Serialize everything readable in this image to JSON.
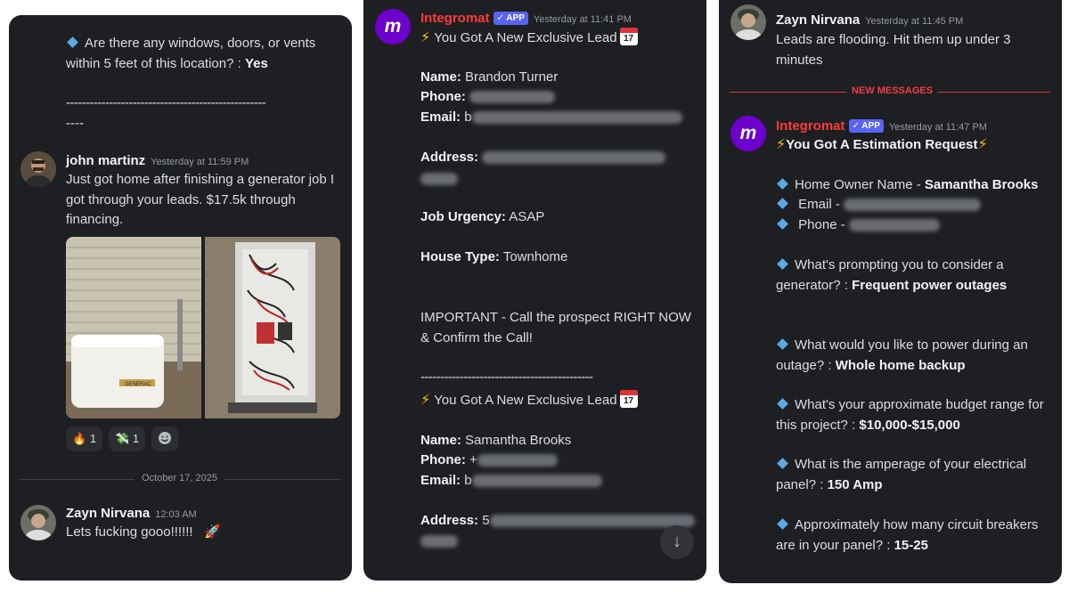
{
  "panel1": {
    "question": "Are there any windows, doors, or vents within 5 feet of this location? :",
    "answer": "Yes",
    "dashes_line1": "---------------------------------------------------",
    "dashes_line2": "----",
    "msg1": {
      "user": "john martinz",
      "time": "Yesterday at 11:59 PM",
      "text": "Just got home after finishing a generator job I got through your leads. $17.5k through financing.",
      "image_brand": "GENERAC"
    },
    "reactions": [
      {
        "emoji": "🔥",
        "count": "1"
      },
      {
        "emoji": "💸",
        "count": "1"
      }
    ],
    "date_separator": "October 17, 2025",
    "msg2": {
      "user": "Zayn Nirvana",
      "time": "12:03 AM",
      "text": "Lets fucking gooo!!!!!!",
      "emoji": "🚀"
    }
  },
  "panel2": {
    "app_name": "Integromat",
    "app_badge": "✓ APP",
    "time": "Yesterday at 11:41 PM",
    "lead_title": "You Got A New Exclusive Lead",
    "calendar_day": "17",
    "lead1": {
      "name_label": "Name:",
      "name_value": "Brandon Turner",
      "phone_label": "Phone:",
      "email_label": "Email:",
      "email_prefix": "b",
      "address_label": "Address:",
      "urgency_label": "Job Urgency:",
      "urgency_value": "ASAP",
      "house_label": "House Type:",
      "house_value": "Townhome",
      "important": "IMPORTANT - Call the prospect RIGHT NOW & Confirm the Call!",
      "dashes": "--------------------------------------------"
    },
    "lead2": {
      "name_label": "Name:",
      "name_value": "Samantha Brooks",
      "phone_label": "Phone:",
      "phone_prefix": "+",
      "email_label": "Email:",
      "email_prefix": "b",
      "address_label": "Address:",
      "address_prefix": "5"
    },
    "scroll_icon": "↓"
  },
  "panel3": {
    "top_msg": {
      "user": "Zayn Nirvana",
      "time": "Yesterday at 11:45 PM",
      "text": "Leads are flooding. Hit them up under 3 minutes"
    },
    "new_messages": "NEW MESSAGES",
    "app_name": "Integromat",
    "app_badge": "✓ APP",
    "time": "Yesterday at 11:47 PM",
    "title": "You Got A Estimation Request",
    "homeowner_label": "Home Owner Name -",
    "homeowner_value": "Samantha Brooks",
    "email_label": "Email -",
    "phone_label": "Phone -",
    "q1": "What's prompting you to consider a generator? :",
    "a1": "Frequent power outages",
    "q2": "What would you like to power during an outage? :",
    "a2": "Whole home backup",
    "q3": "What's your approximate budget range for this project?  :",
    "a3": "$10,000-$15,000",
    "q4": "What is the amperage of your electrical panel?  :",
    "a4": "150 Amp",
    "q5": "Approximately how many circuit breakers are in your panel?  :",
    "a5": "15-25"
  },
  "colors": {
    "panel_bg": "#1e1f22",
    "text": "#dbdee1",
    "accent_red": "#ff3b3b",
    "badge_blue": "#5865f2",
    "diamond_blue": "#5fa8e8"
  }
}
